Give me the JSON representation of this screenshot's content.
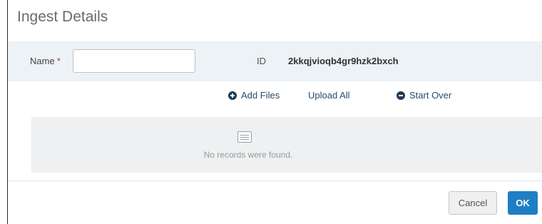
{
  "dialog": {
    "title": "Ingest Details"
  },
  "form": {
    "name_label": "Name",
    "required_marker": "*",
    "name_value": "",
    "name_placeholder": "",
    "id_label": "ID",
    "id_value": "2kkqjvioqb4gr9hzk2bxch"
  },
  "actions": {
    "add_files": "Add Files",
    "upload_all": "Upload All",
    "start_over": "Start Over"
  },
  "records": {
    "empty_text": "No records were found.",
    "icon": "list-icon"
  },
  "footer": {
    "cancel_label": "Cancel",
    "ok_label": "OK"
  },
  "colors": {
    "accent": "#1f7fc4",
    "link": "#2b4a6a",
    "required": "#d62b2b",
    "form_band": "#ecf2f5"
  }
}
